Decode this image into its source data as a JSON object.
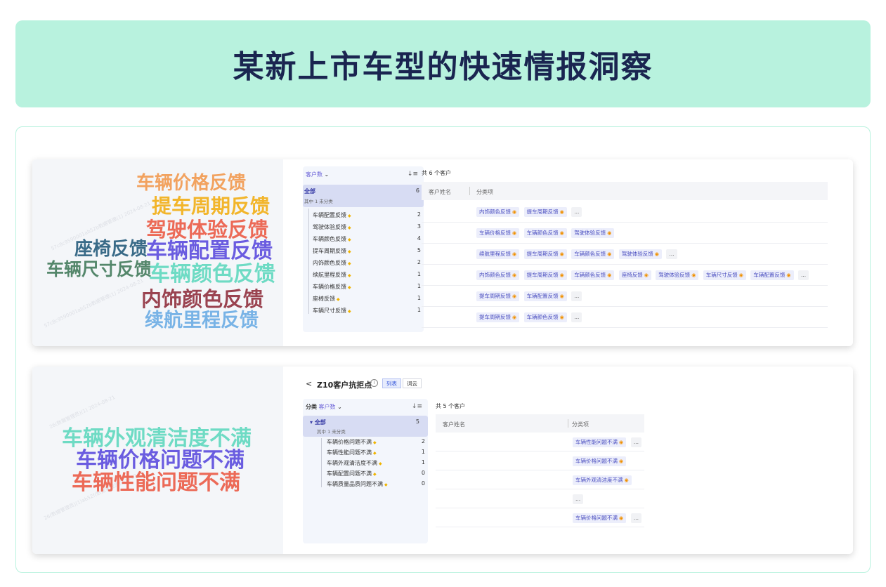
{
  "title": "某新上市车型的快速情报洞察",
  "colors": {
    "banner_bg": "#b8f2de",
    "title": "#1a2550",
    "tag_text": "#4b4fc0",
    "tag_bg": "#eceefb",
    "accent": "#6b62d8"
  },
  "card1": {
    "cloud_words": [
      {
        "text": "车辆价格反馈",
        "color": "#f2a25f"
      },
      {
        "text": "提车周期反馈",
        "color": "#f2b52b"
      },
      {
        "text": "驾驶体验反馈",
        "color": "#ec6a57"
      },
      {
        "text": "座椅反馈",
        "color": "#3a6b88"
      },
      {
        "text": "车辆配置反馈",
        "color": "#6a5ce0"
      },
      {
        "text": "车辆尺寸反馈",
        "color": "#54876b"
      },
      {
        "text": "车辆颜色反馈",
        "color": "#6edbc4"
      },
      {
        "text": "内饰颜色反馈",
        "color": "#9a4350"
      },
      {
        "text": "续航里程反馈",
        "color": "#78b3e6"
      }
    ],
    "tree": {
      "sort_label": "客户数",
      "all_label": "全部",
      "all_count": "6",
      "sub_label": "其中 1 未分类",
      "items": [
        {
          "label": "车辆配置反馈",
          "count": "2"
        },
        {
          "label": "驾驶体验反馈",
          "count": "3"
        },
        {
          "label": "车辆颜色反馈",
          "count": "4"
        },
        {
          "label": "提车周期反馈",
          "count": "5"
        },
        {
          "label": "内饰颜色反馈",
          "count": "2"
        },
        {
          "label": "续航里程反馈",
          "count": "1"
        },
        {
          "label": "车辆价格反馈",
          "count": "1"
        },
        {
          "label": "座椅反馈",
          "count": "1"
        },
        {
          "label": "车辆尺寸反馈",
          "count": "1"
        }
      ]
    },
    "total": "共 6 个客户",
    "columns": [
      "客户姓名",
      "分类项"
    ],
    "rows": [
      [
        "内饰颜色反馈",
        "提车周期反馈",
        "..."
      ],
      [
        "车辆价格反馈",
        "车辆颜色反馈",
        "驾驶体验反馈"
      ],
      [
        "续航里程反馈",
        "提车周期反馈",
        "车辆颜色反馈",
        "驾驶体验反馈",
        "..."
      ],
      [
        "内饰颜色反馈",
        "提车周期反馈",
        "车辆颜色反馈",
        "座椅反馈",
        "驾驶体验反馈",
        "车辆尺寸反馈",
        "车辆配置反馈",
        "..."
      ],
      [
        "提车周期反馈",
        "车辆配置反馈",
        "..."
      ],
      [
        "提车周期反馈",
        "车辆颜色反馈",
        "..."
      ]
    ]
  },
  "card2": {
    "cloud_words": [
      {
        "text": "车辆外观清洁度不满",
        "color": "#6edbc4"
      },
      {
        "text": "车辆价格问题不满",
        "color": "#6a5ce0"
      },
      {
        "text": "车辆性能问题不满",
        "color": "#ec6a57"
      }
    ],
    "header": {
      "back": "<",
      "title": "Z10客户抗拒点",
      "info": "i",
      "view_list": "列表",
      "view_cloud": "词云"
    },
    "tree": {
      "group_label": "分类",
      "sort_label": "客户数",
      "all_label": "全部",
      "all_count": "5",
      "sub_label": "其中 1 未分类",
      "items": [
        {
          "label": "车辆价格问题不满",
          "count": "2"
        },
        {
          "label": "车辆性能问题不满",
          "count": "1"
        },
        {
          "label": "车辆外观清洁度不满",
          "count": "1"
        },
        {
          "label": "车辆配置问题不满",
          "count": "0"
        },
        {
          "label": "车辆质量品质问题不满",
          "count": "0"
        }
      ]
    },
    "total": "共 5 个客户",
    "columns": [
      "客户姓名",
      "分类项"
    ],
    "rows": [
      [
        "车辆性能问题不满",
        "..."
      ],
      [
        "车辆价格问题不满"
      ],
      [
        "车辆外观清洁度不满"
      ],
      [
        "..."
      ],
      [
        "车辆价格问题不满",
        "..."
      ]
    ]
  }
}
